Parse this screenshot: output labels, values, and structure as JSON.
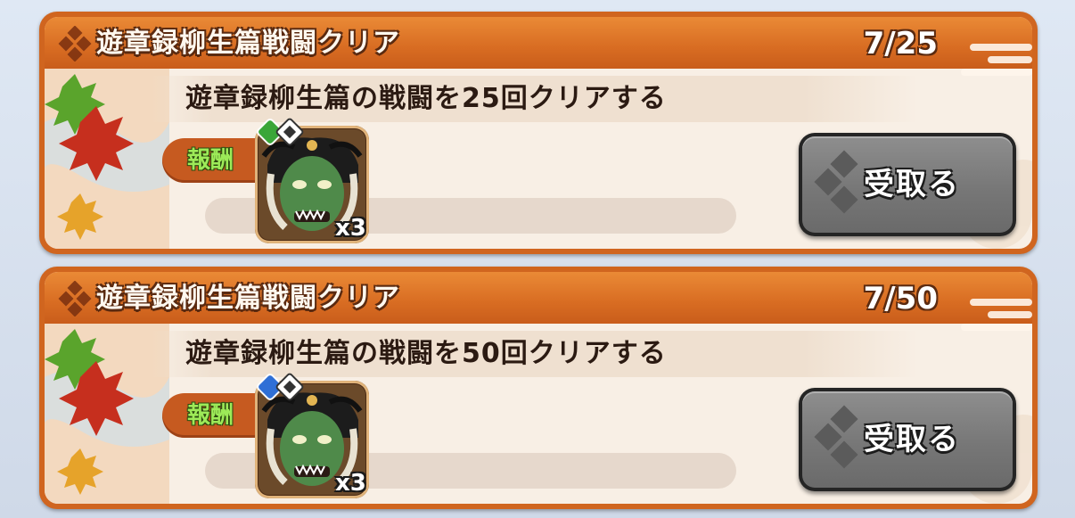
{
  "missions": [
    {
      "title": "遊章録柳生篇戦闘クリア",
      "progress": "7/25",
      "description": "遊章録柳生篇の戦闘を25回クリアする",
      "reward_label": "報酬",
      "reward_item": {
        "icon": "green-oni-mask-icon",
        "quantity": "x3",
        "badge_color": "#3aa638"
      },
      "claim_label": "受取る"
    },
    {
      "title": "遊章録柳生篇戦闘クリア",
      "progress": "7/50",
      "description": "遊章録柳生篇の戦闘を50回クリアする",
      "reward_label": "報酬",
      "reward_item": {
        "icon": "green-oni-mask-icon",
        "quantity": "x3",
        "badge_color": "#2f6fd6"
      },
      "claim_label": "受取る"
    }
  ],
  "colors": {
    "card_frame": "#d0651f",
    "card_body": "#f8efe5",
    "button": "#7a7a7a"
  }
}
